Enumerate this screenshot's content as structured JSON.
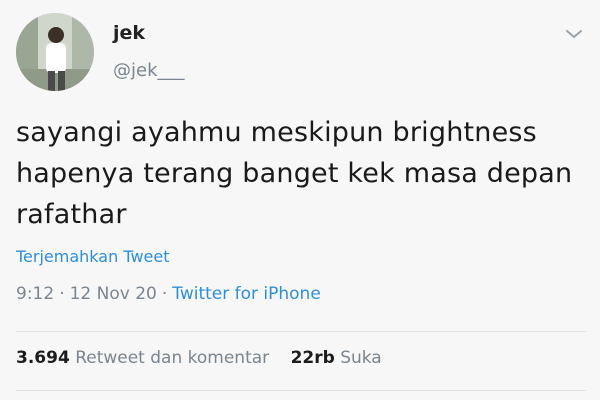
{
  "author": {
    "name": "jek",
    "handle": "@jek___"
  },
  "tweet": {
    "text_lines": [
      "sayangi ayahmu meskipun brightness",
      "hapenya terang banget kek masa depan",
      "rafathar"
    ],
    "translate_label": "Terjemahkan Tweet",
    "time": "9:12",
    "date": "12 Nov 20",
    "separator": "·",
    "source": "Twitter for iPhone"
  },
  "stats": {
    "retweets_count": "3.694",
    "retweets_label": "Retweet dan komentar",
    "likes_count": "22rb",
    "likes_label": "Suka"
  },
  "icons": {
    "menu": "chevron-down-icon",
    "avatar": "profile-photo"
  },
  "colors": {
    "link": "#2e8fd8",
    "muted": "#7a8590",
    "background": "#f7f7f7"
  }
}
